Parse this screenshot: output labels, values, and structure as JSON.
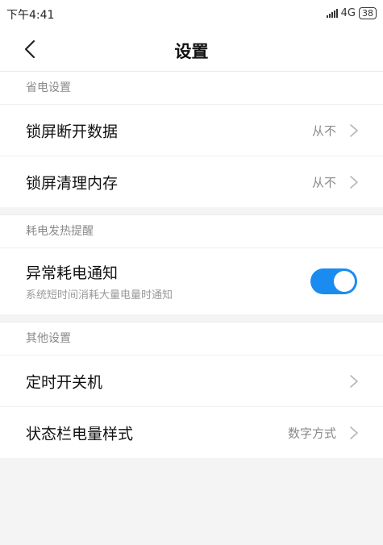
{
  "status_bar": {
    "time": "下午4:41",
    "network": "4G",
    "battery": "38"
  },
  "header": {
    "title": "设置",
    "back_icon": "chevron-left-icon"
  },
  "sections": [
    {
      "header": "省电设置",
      "rows": [
        {
          "title": "锁屏断开数据",
          "value": "从不"
        },
        {
          "title": "锁屏清理内存",
          "value": "从不"
        }
      ]
    },
    {
      "header": "耗电发热提醒",
      "rows": [
        {
          "title": "异常耗电通知",
          "subtitle": "系统短时间消耗大量电量时通知",
          "toggle_on": true
        }
      ]
    },
    {
      "header": "其他设置",
      "rows": [
        {
          "title": "定时开关机",
          "value": ""
        },
        {
          "title": "状态栏电量样式",
          "value": "数字方式"
        }
      ]
    }
  ],
  "colors": {
    "accent": "#1a8cf0",
    "background": "#f4f4f4",
    "secondary_text": "#8a8a8a"
  }
}
